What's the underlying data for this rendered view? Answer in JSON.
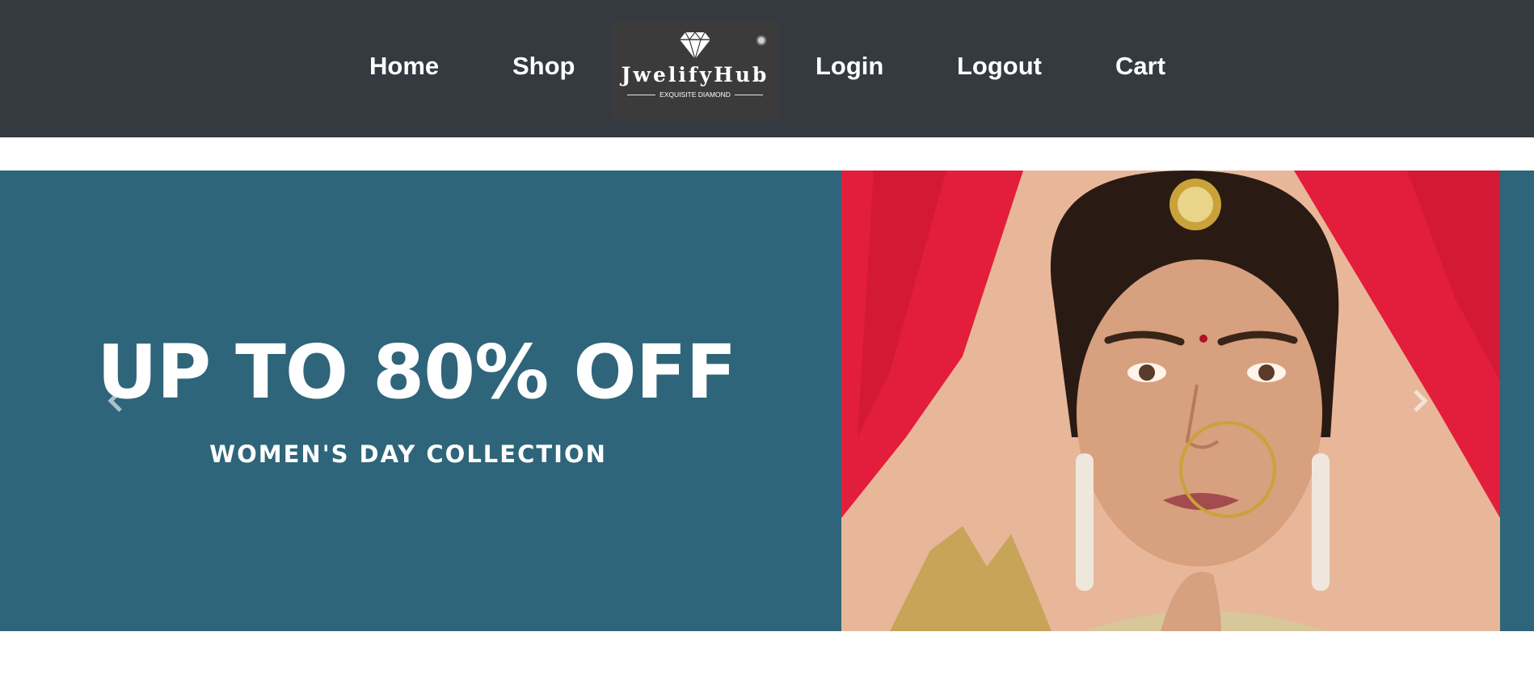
{
  "nav": {
    "home": "Home",
    "shop": "Shop",
    "login": "Login",
    "logout": "Logout",
    "cart": "Cart"
  },
  "logo": {
    "name": "JwelifyHub",
    "tagline": "EXQUISITE DIAMOND",
    "icon": "diamond-icon"
  },
  "banner": {
    "headline": "UP TO 80% OFF",
    "subline": "WOMEN'S DAY COLLECTION",
    "prev_icon": "chevron-left-icon",
    "next_icon": "chevron-right-icon"
  },
  "colors": {
    "navbar": "#343a40",
    "banner_background": "#2e657a",
    "text": "#ffffff",
    "curtain": "#e31e3c"
  }
}
